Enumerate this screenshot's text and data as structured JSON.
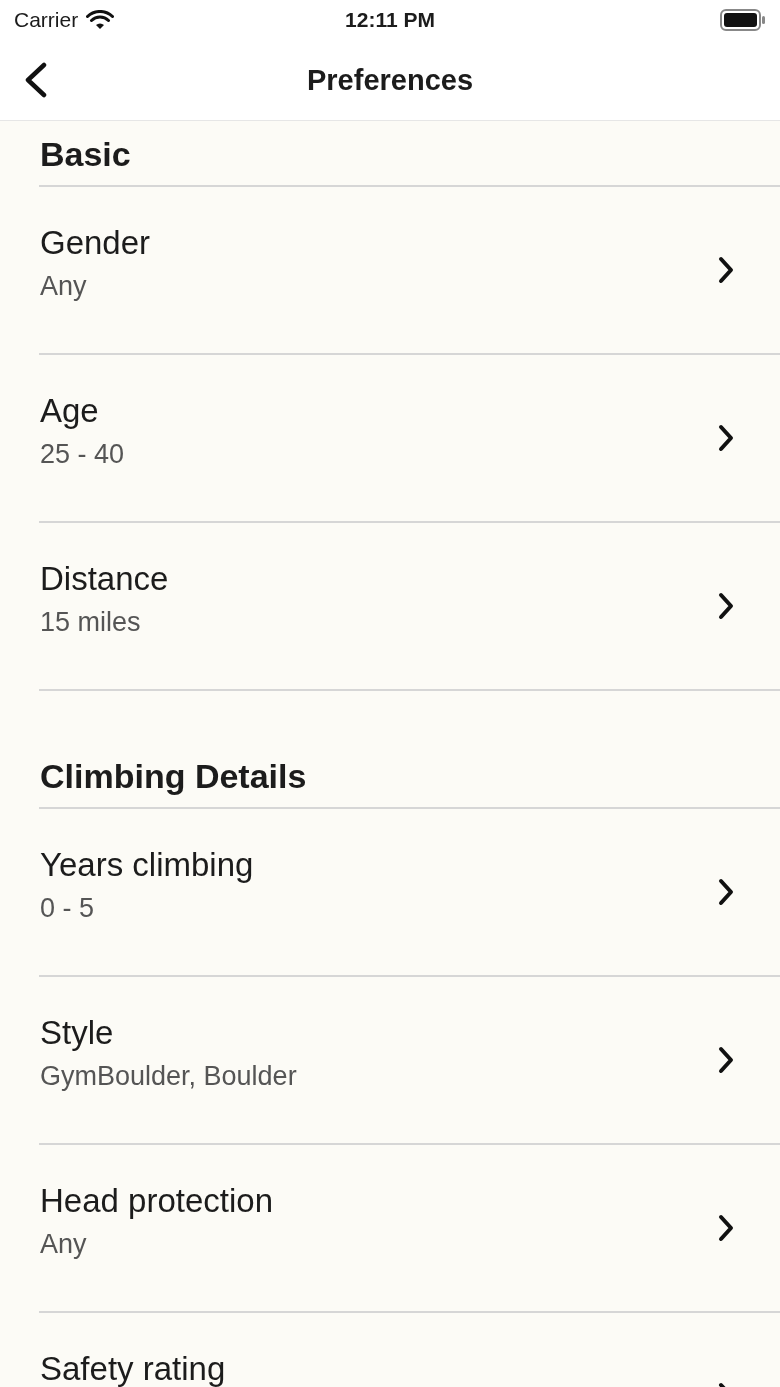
{
  "status_bar": {
    "carrier": "Carrier",
    "time": "12:11 PM"
  },
  "nav": {
    "title": "Preferences"
  },
  "sections": [
    {
      "title": "Basic",
      "rows": [
        {
          "title": "Gender",
          "value": "Any"
        },
        {
          "title": "Age",
          "value": "25 - 40"
        },
        {
          "title": "Distance",
          "value": "15 miles"
        }
      ]
    },
    {
      "title": "Climbing Details",
      "rows": [
        {
          "title": "Years climbing",
          "value": "0 - 5"
        },
        {
          "title": "Style",
          "value": "GymBoulder, Boulder"
        },
        {
          "title": "Head protection",
          "value": "Any"
        },
        {
          "title": "Safety rating"
        }
      ]
    }
  ]
}
